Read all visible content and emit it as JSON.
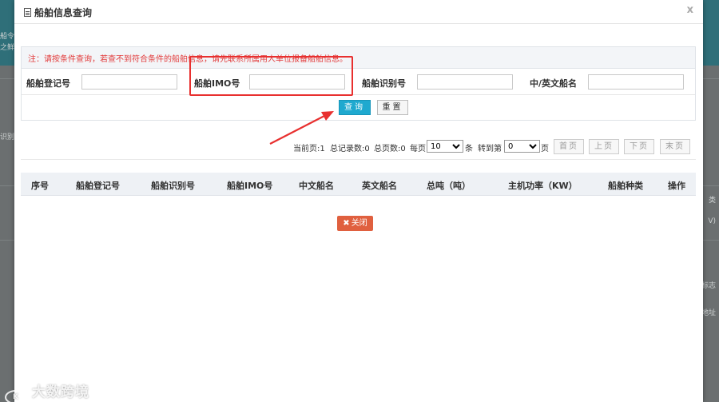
{
  "modal": {
    "title": "船舶信息查询",
    "close_label": "x"
  },
  "search": {
    "notice": "注：请按条件查询，若查不到符合条件的船舶信息，请先联系所属用人单位报备船舶信息。",
    "fields": [
      {
        "label": "船舶登记号",
        "value": ""
      },
      {
        "label": "船舶IMO号",
        "value": ""
      },
      {
        "label": "船舶识别号",
        "value": ""
      },
      {
        "label": "中/英文船名",
        "value": ""
      }
    ],
    "query_label": "查询",
    "reset_label": "重置"
  },
  "pager": {
    "current_page": "当前页:1",
    "total_records": "总记录数:0",
    "total_pages": "总页数:0",
    "per_page_prefix": "每页",
    "per_page_value": "10",
    "per_page_suffix": "条",
    "goto_prefix": "转到第",
    "goto_value": "0",
    "goto_suffix": "页",
    "first": "首页",
    "prev": "上页",
    "next": "下页",
    "last": "末页"
  },
  "table": {
    "columns": [
      "序号",
      "船舶登记号",
      "船舶识别号",
      "船舶IMO号",
      "中文船名",
      "英文船名",
      "总吨（吨）",
      "主机功率（KW）",
      "船舶种类",
      "操作"
    ],
    "rows": []
  },
  "footer": {
    "close_label": "关闭"
  },
  "background": {
    "left_snippets": [
      "船令",
      "之鲜",
      "识别"
    ],
    "right_snippets": [
      "类",
      "V)",
      "识标志",
      "识地址"
    ]
  },
  "watermark": {
    "logo_text": "K",
    "text": "大数跨境"
  },
  "colors": {
    "accent_blue": "#1fa9cf",
    "danger_red": "#e8302f",
    "close_orange": "#e0603f",
    "notice_red": "#e23c3c"
  }
}
